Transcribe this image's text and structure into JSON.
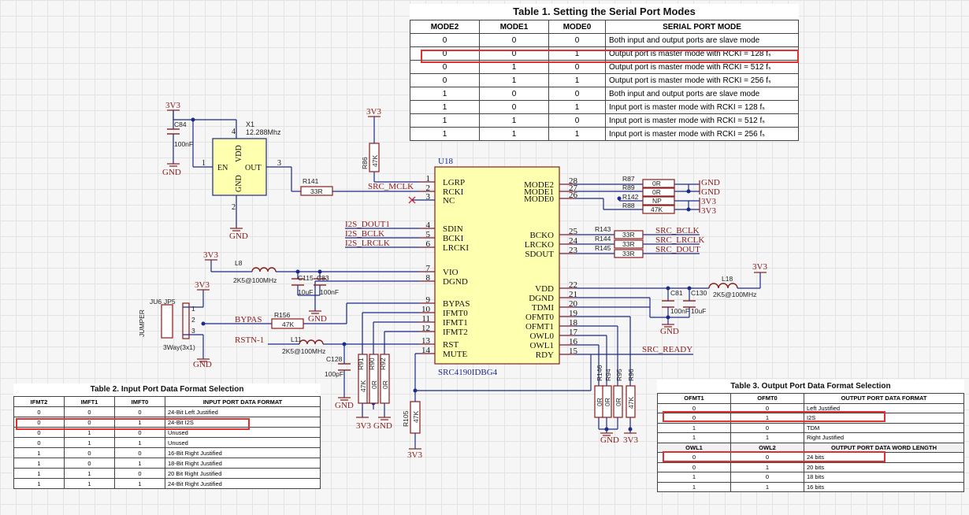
{
  "table1": {
    "title": "Table 1. Setting the Serial Port Modes",
    "headers": [
      "MODE2",
      "MODE1",
      "MODE0",
      "SERIAL PORT MODE"
    ],
    "rows": [
      [
        "0",
        "0",
        "0",
        "Both input and output ports are slave mode"
      ],
      [
        "0",
        "0",
        "1",
        "Output port is master mode with RCKI = 128 fₛ"
      ],
      [
        "0",
        "1",
        "0",
        "Output port is master mode with RCKI = 512 fₛ"
      ],
      [
        "0",
        "1",
        "1",
        "Output port is master mode with RCKI = 256 fₛ"
      ],
      [
        "1",
        "0",
        "0",
        "Both input and output ports are slave mode"
      ],
      [
        "1",
        "0",
        "1",
        "Input port is master mode with RCKI = 128 fₛ"
      ],
      [
        "1",
        "1",
        "0",
        "Input port is master mode with RCKI = 512 fₛ"
      ],
      [
        "1",
        "1",
        "1",
        "Input port is master mode with RCKI = 256 fₛ"
      ]
    ]
  },
  "table2": {
    "title": "Table 2. Input Port Data Format Selection",
    "headers": [
      "IFMT2",
      "IMFT1",
      "IMFT0",
      "INPUT PORT DATA FORMAT"
    ],
    "rows": [
      [
        "0",
        "0",
        "0",
        "24-Bit Left Justified"
      ],
      [
        "0",
        "0",
        "1",
        "24-Bit I2S"
      ],
      [
        "0",
        "1",
        "0",
        "Unused"
      ],
      [
        "0",
        "1",
        "1",
        "Unused"
      ],
      [
        "1",
        "0",
        "0",
        "16-Bit Right Justified"
      ],
      [
        "1",
        "0",
        "1",
        "18-Bit Right Justified"
      ],
      [
        "1",
        "1",
        "0",
        "20 Bit Right Justified"
      ],
      [
        "1",
        "1",
        "1",
        "24-Bit Right Justified"
      ]
    ]
  },
  "table3": {
    "title": "Table 3. Output Port Data Format Selection",
    "headers": [
      "OFMT1",
      "OFMT0",
      "OUTPUT PORT DATA FORMAT"
    ],
    "rows": [
      [
        "0",
        "0",
        "Left Justified"
      ],
      [
        "0",
        "1",
        "I2S"
      ],
      [
        "1",
        "0",
        "TDM"
      ],
      [
        "1",
        "1",
        "Right Justified"
      ]
    ],
    "sub_headers": [
      "OWL1",
      "OWL2",
      "OUTPUT PORT DATA WORD LENGTH"
    ],
    "sub_rows": [
      [
        "0",
        "0",
        "24 bits"
      ],
      [
        "0",
        "1",
        "20 bits"
      ],
      [
        "1",
        "0",
        "18 bits"
      ],
      [
        "1",
        "1",
        "16 bits"
      ]
    ]
  },
  "schematic": {
    "ic": {
      "ref": "U18",
      "part": "SRC4190IDBG4",
      "left_pins": [
        {
          "num": "1",
          "name": "LGRP"
        },
        {
          "num": "2",
          "name": "RCKI"
        },
        {
          "num": "3",
          "name": "NC"
        },
        {
          "num": "4",
          "name": "SDIN"
        },
        {
          "num": "5",
          "name": "BCKI"
        },
        {
          "num": "6",
          "name": "LRCKI"
        },
        {
          "num": "7",
          "name": "VIO"
        },
        {
          "num": "8",
          "name": "DGND"
        },
        {
          "num": "9",
          "name": "BYPAS"
        },
        {
          "num": "10",
          "name": "IFMT0"
        },
        {
          "num": "11",
          "name": "IFMT1"
        },
        {
          "num": "12",
          "name": "IFMT2"
        },
        {
          "num": "13",
          "name": "RST"
        },
        {
          "num": "14",
          "name": "MUTE"
        }
      ],
      "right_pins": [
        {
          "num": "28",
          "name": "MODE2"
        },
        {
          "num": "27",
          "name": "MODE1"
        },
        {
          "num": "26",
          "name": "MODE0"
        },
        {
          "num": "25",
          "name": "BCKO"
        },
        {
          "num": "24",
          "name": "LRCKO"
        },
        {
          "num": "23",
          "name": "SDOUT"
        },
        {
          "num": "22",
          "name": "VDD"
        },
        {
          "num": "21",
          "name": "DGND"
        },
        {
          "num": "20",
          "name": "TDMI"
        },
        {
          "num": "19",
          "name": "OFMT0"
        },
        {
          "num": "18",
          "name": "OFMT1"
        },
        {
          "num": "17",
          "name": "OWL0"
        },
        {
          "num": "16",
          "name": "OWL1"
        },
        {
          "num": "15",
          "name": "RDY"
        }
      ]
    },
    "osc": {
      "ref": "X1",
      "freq": "12.288Mhz",
      "en": "EN",
      "out": "OUT",
      "vdd": "VDD",
      "gnd": "GND",
      "p1": "1",
      "p2": "2",
      "p3": "3",
      "p4": "4"
    },
    "nets": {
      "src_mclk": "SRC_MCLK",
      "dout1": "I2S_DOUT1",
      "bclk": "I2S_BCLK",
      "lrclk": "I2S_LRCLK",
      "src_bclk": "SRC_BCLK",
      "src_lrclk": "SRC_LRCLK",
      "src_dout": "SRC_DOUT",
      "bypas": "BYPAS",
      "rstn": "RSTN-1",
      "src_ready": "SRC_READY"
    },
    "power": {
      "v3": "3V3",
      "gnd": "GND"
    },
    "parts": {
      "c84": "C84",
      "c84_val": "100nF",
      "r141": "R141",
      "r141_val": "33R",
      "r86": "R86",
      "r86_val": "47K",
      "l8": "L8",
      "l8_val": "2K5@100MHz",
      "c115": "C115",
      "c83": "C83",
      "c115_val": "10uF",
      "c83_val": "100nF",
      "r87": "R87",
      "r87_val": "0R",
      "r89": "R89",
      "r89_val": "0R",
      "r142": "R142",
      "r142_val": "NP",
      "r88": "R88",
      "r88_val": "47K",
      "r143": "R143",
      "r144": "R144",
      "r145": "R145",
      "r33_val": "33R",
      "l18": "L18",
      "l18_val": "2K5@100MHz",
      "c81": "C81",
      "c130": "C130",
      "c81_val": "100nF",
      "c130_val": "10uF",
      "ju6": "JU6",
      "jp5": "JP5",
      "jumper": "JUMPER",
      "jp_val": "3Way(3x1)",
      "r156": "R156",
      "r156_val": "47K",
      "l11": "L11",
      "l11_val": "2K5@100MHz",
      "c128": "C128",
      "c128_val": "100pF",
      "r91": "R91",
      "r91_val": "47K",
      "r90": "R90",
      "r90_val": "0R",
      "r92": "R92",
      "r92_val": "0R",
      "r105": "R105",
      "r105_val": "47K",
      "r146": "R146",
      "r146_val": "0R",
      "r94": "R94",
      "r94_val": "0R",
      "r95": "R95",
      "r95_val": "0R",
      "r96": "R96",
      "r96_val": "47K",
      "jp_p1": "1",
      "jp_p2": "2",
      "jp_p3": "3"
    },
    "colors": {
      "wire": "#1c2a8a",
      "part": "#8a1c1c",
      "ic_fill": "#ffffb0",
      "highlight": "#e03030"
    }
  }
}
